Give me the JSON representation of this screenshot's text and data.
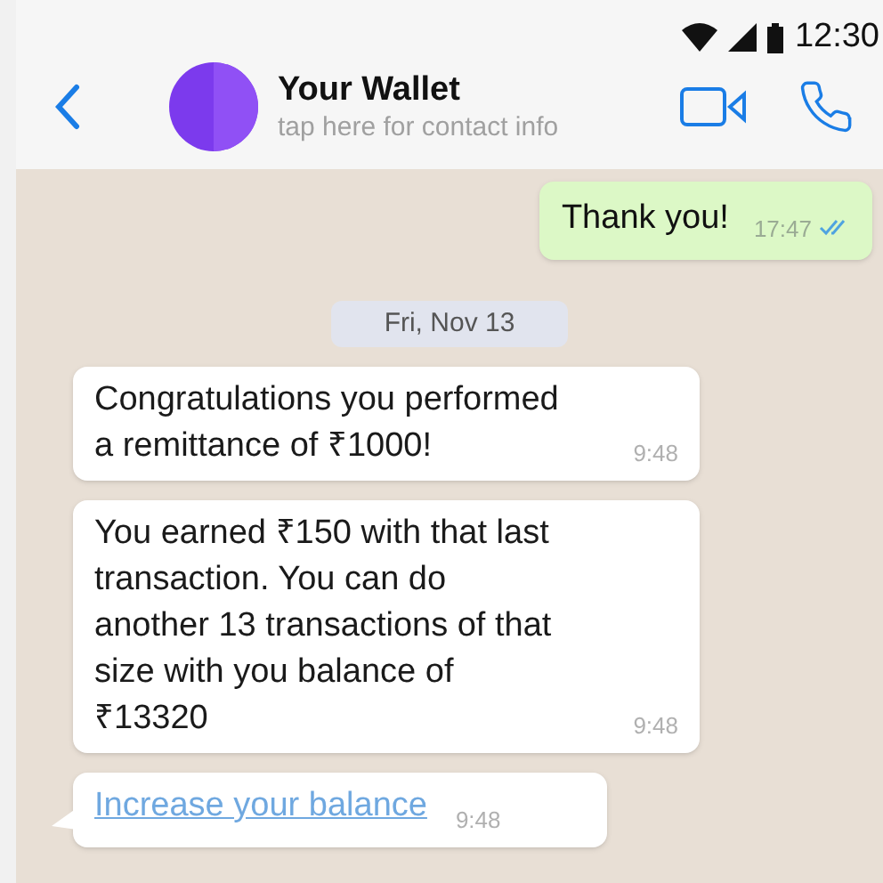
{
  "status_bar": {
    "time": "12:30"
  },
  "header": {
    "title": "Your Wallet",
    "subtitle": "tap here for contact info"
  },
  "messages": [
    {
      "kind": "sent",
      "lines": [
        "Thank you!"
      ],
      "time": "17:47",
      "read": true
    },
    {
      "kind": "date",
      "lines": [
        "Fri, Nov 13"
      ]
    },
    {
      "kind": "received",
      "lines": [
        "Congratulations you performed",
        "a remittance of ₹1000!"
      ],
      "time": "9:48"
    },
    {
      "kind": "received",
      "lines": [
        "You earned ₹150 with that last",
        "transaction. You can do",
        "another 13 transactions of that",
        "size with you balance of",
        "₹13320"
      ],
      "time": "9:48"
    },
    {
      "kind": "link",
      "lines": [
        "Increase your balance"
      ],
      "time": "9:48",
      "tail": true
    }
  ]
}
